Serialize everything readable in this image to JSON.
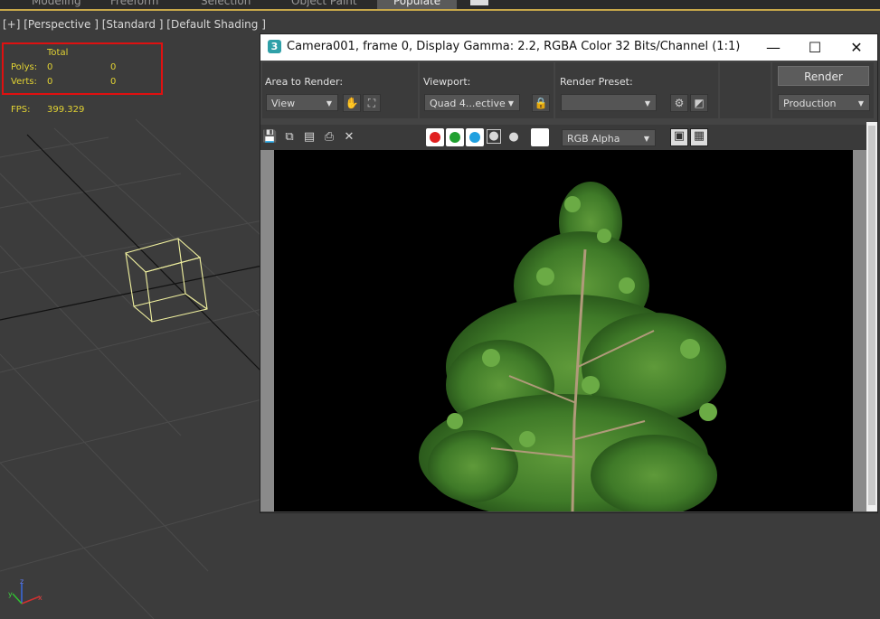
{
  "ribbon": {
    "tabs": [
      "Modeling",
      "Freeform",
      "Selection",
      "Object Paint",
      "Populate"
    ],
    "active_tab": "Populate"
  },
  "viewport": {
    "label": "[+] [Perspective ] [Standard ] [Default Shading ]",
    "stats": {
      "header": "Total",
      "polys_label": "Polys:",
      "polys_value": "0",
      "polys_total": "0",
      "verts_label": "Verts:",
      "verts_value": "0",
      "verts_total": "0"
    },
    "fps_label": "FPS:",
    "fps_value": "399.329",
    "axis_labels": {
      "x": "x",
      "y": "y",
      "z": "z"
    }
  },
  "render_window": {
    "app_icon": "3",
    "title": "Camera001, frame 0, Display Gamma: 2.2, RGBA Color 32 Bits/Channel (1:1)",
    "controls": {
      "minimize": "—",
      "maximize": "☐",
      "close": "✕"
    },
    "area_to_render_label": "Area to Render:",
    "area_to_render_value": "View",
    "viewport_label": "Viewport:",
    "viewport_value": "Quad 4...ective",
    "render_preset_label": "Render Preset:",
    "render_preset_value": "",
    "render_button": "Render",
    "production_value": "Production",
    "channel_value": "RGB Alpha",
    "colors": {
      "red_channel": "#e02020",
      "green_channel": "#20a030",
      "blue_channel": "#20a0e0",
      "title_bar": "#ffffff",
      "stats_border": "#e01010",
      "stats_text": "#e3d433"
    }
  }
}
